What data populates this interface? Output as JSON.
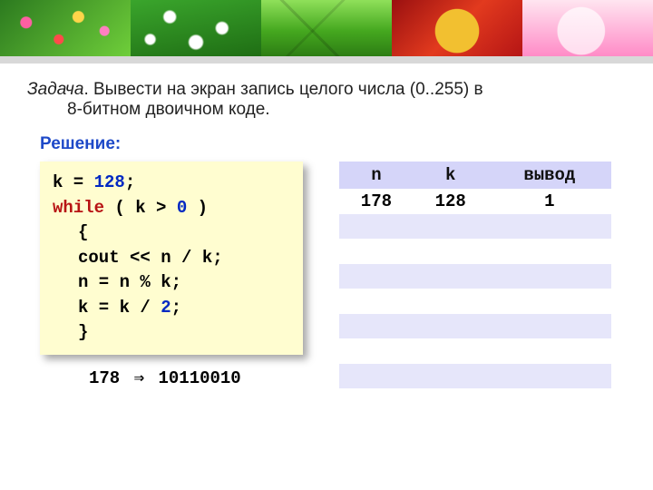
{
  "task": {
    "word": "Задача",
    "line1_rest": ". Вывести на экран запись целого числа (0..255) в",
    "line2": "8-битном двоичном коде."
  },
  "solution_label": "Решение:",
  "code": {
    "l1a": "k = ",
    "l1num": "128",
    "l1b": ";",
    "kw_while": "while",
    "l2rest": " ( k > ",
    "l2zero": "0",
    "l2end": " )",
    "l3": "{",
    "l4": "cout << n / k;",
    "l5": "n = n % k;",
    "l6a": "k = k / ",
    "l6num": "2",
    "l6b": ";",
    "l7": "}"
  },
  "result": {
    "lhs": "178",
    "arrow": "⇒",
    "rhs": "10110010"
  },
  "table": {
    "headers": [
      "n",
      "k",
      "вывод"
    ],
    "rows": [
      {
        "n": "178",
        "k": "128",
        "out": "1"
      }
    ]
  }
}
